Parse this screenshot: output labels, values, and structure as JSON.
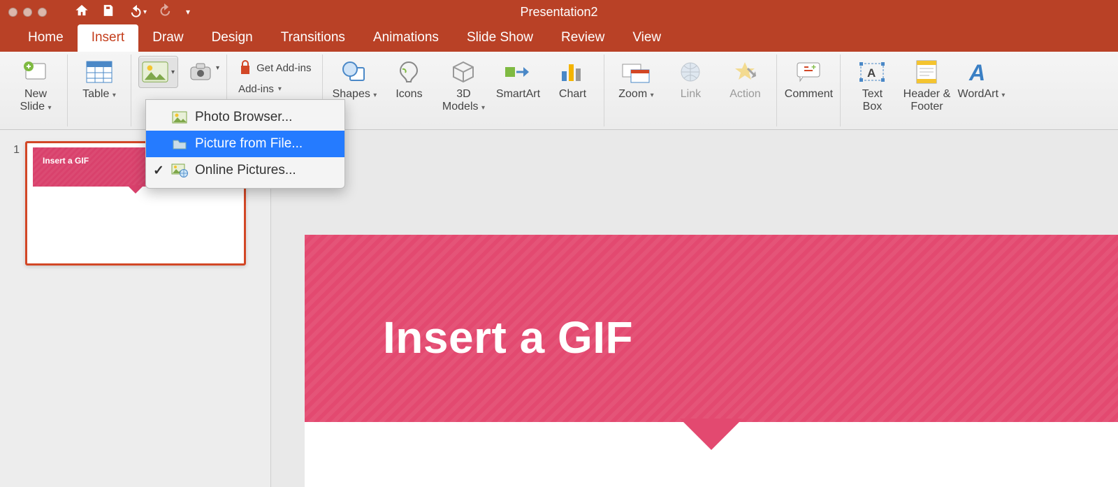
{
  "title": "Presentation2",
  "tabs": [
    "Home",
    "Insert",
    "Draw",
    "Design",
    "Transitions",
    "Animations",
    "Slide Show",
    "Review",
    "View"
  ],
  "activeTab": 1,
  "ribbon": {
    "newSlide": "New\nSlide",
    "table": "Table",
    "getAddins": "Get Add-ins",
    "myAddins": "Add-ins",
    "shapes": "Shapes",
    "icons": "Icons",
    "models3d": "3D\nModels",
    "smartart": "SmartArt",
    "chart": "Chart",
    "zoom": "Zoom",
    "link": "Link",
    "action": "Action",
    "comment": "Comment",
    "textbox": "Text\nBox",
    "headerfooter": "Header &\nFooter",
    "wordart": "WordArt"
  },
  "picMenu": {
    "photoBrowser": "Photo Browser...",
    "fromFile": "Picture from File...",
    "online": "Online Pictures..."
  },
  "thumbs": {
    "slideNum": "1",
    "slideTitle": "Insert a GIF"
  },
  "canvas": {
    "title": "Insert a GIF"
  }
}
